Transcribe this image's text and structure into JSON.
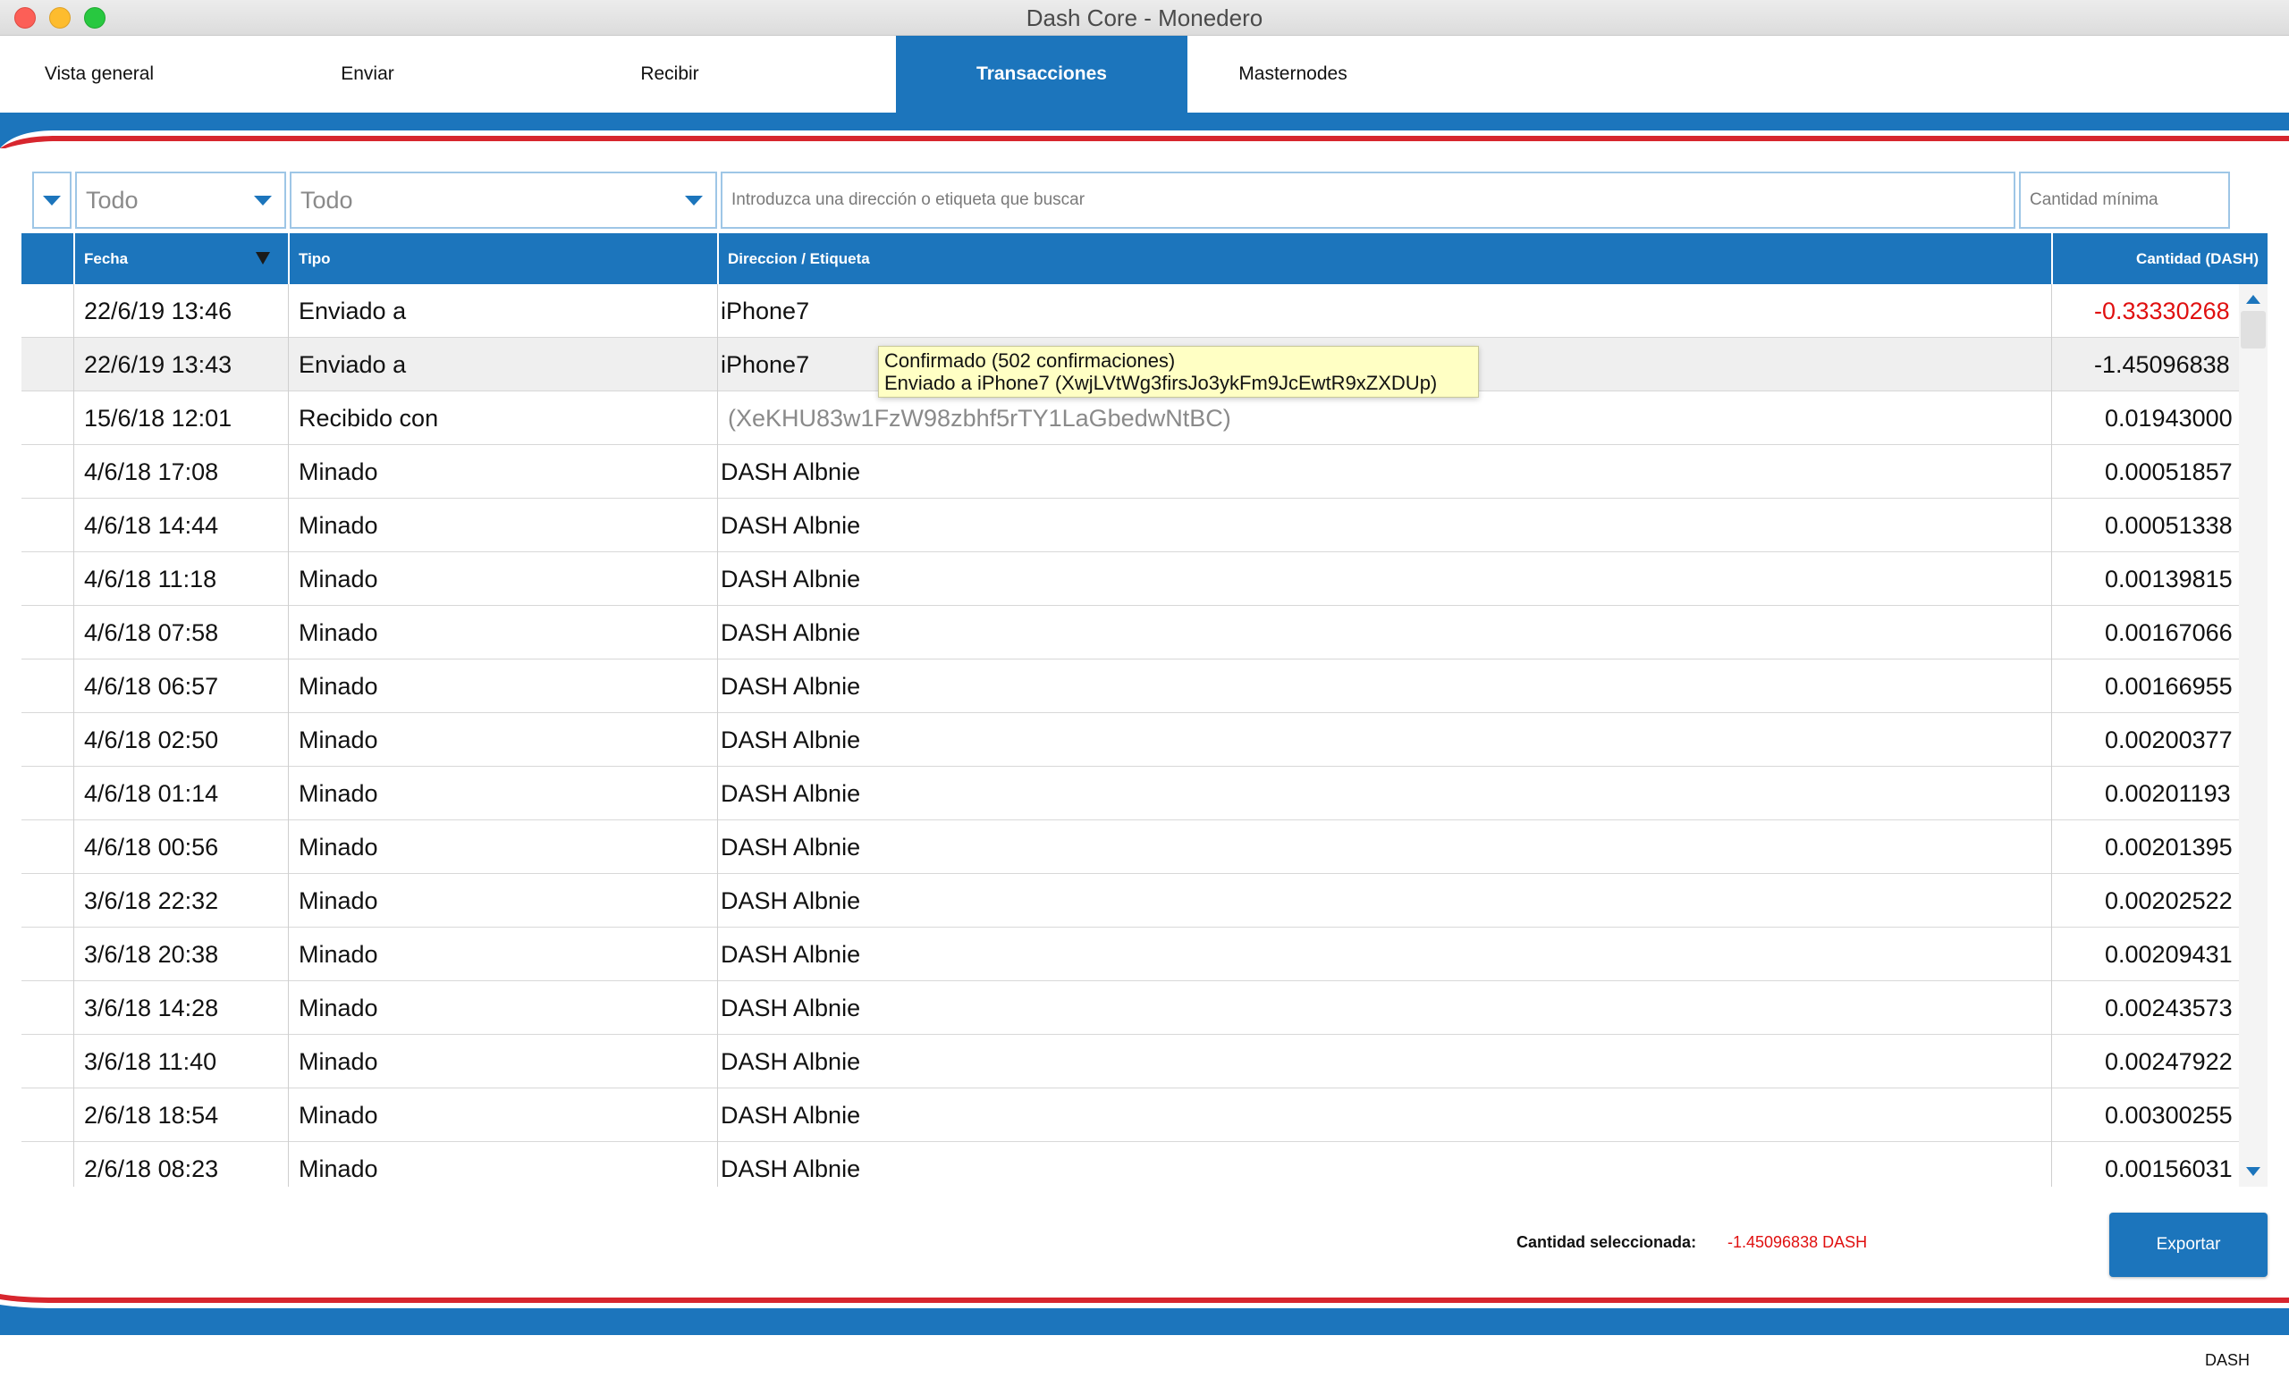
{
  "window": {
    "title": "Dash Core - Monedero"
  },
  "tabs": [
    {
      "label": "Vista general"
    },
    {
      "label": "Enviar"
    },
    {
      "label": "Recibir"
    },
    {
      "label": "Transacciones"
    },
    {
      "label": "Masternodes"
    }
  ],
  "filters": {
    "date_value": "Todo",
    "type_value": "Todo",
    "search_placeholder": "Introduzca una dirección o etiqueta que buscar",
    "min_amount_placeholder": "Cantidad mínima"
  },
  "table": {
    "columns": [
      "Fecha",
      "Tipo",
      "Direccion / Etiqueta",
      "Cantidad (DASH)"
    ],
    "rows": [
      {
        "date": "22/6/19 13:46",
        "type": "Enviado a",
        "label": "iPhone7",
        "amount": "-0.33330268"
      },
      {
        "date": "22/6/19 13:43",
        "type": "Enviado a",
        "label": "iPhone7",
        "amount": "-1.45096838"
      },
      {
        "date": "15/6/18 12:01",
        "type": "Recibido con",
        "label": "(XeKHU83w1FzW98zbhf5rTY1LaGbedwNtBC)",
        "amount": "0.01943000"
      },
      {
        "date": "4/6/18 17:08",
        "type": "Minado",
        "label": "DASH Albnie",
        "amount": "0.00051857"
      },
      {
        "date": "4/6/18 14:44",
        "type": "Minado",
        "label": "DASH Albnie",
        "amount": "0.00051338"
      },
      {
        "date": "4/6/18 11:18",
        "type": "Minado",
        "label": "DASH Albnie",
        "amount": "0.00139815"
      },
      {
        "date": "4/6/18 07:58",
        "type": "Minado",
        "label": "DASH Albnie",
        "amount": "0.00167066"
      },
      {
        "date": "4/6/18 06:57",
        "type": "Minado",
        "label": "DASH Albnie",
        "amount": "0.00166955"
      },
      {
        "date": "4/6/18 02:50",
        "type": "Minado",
        "label": "DASH Albnie",
        "amount": "0.00200377"
      },
      {
        "date": "4/6/18 01:14",
        "type": "Minado",
        "label": "DASH Albnie",
        "amount": "0.00201193"
      },
      {
        "date": "4/6/18 00:56",
        "type": "Minado",
        "label": "DASH Albnie",
        "amount": "0.00201395"
      },
      {
        "date": "3/6/18 22:32",
        "type": "Minado",
        "label": "DASH Albnie",
        "amount": "0.00202522"
      },
      {
        "date": "3/6/18 20:38",
        "type": "Minado",
        "label": "DASH Albnie",
        "amount": "0.00209431"
      },
      {
        "date": "3/6/18 14:28",
        "type": "Minado",
        "label": "DASH Albnie",
        "amount": "0.00243573"
      },
      {
        "date": "3/6/18 11:40",
        "type": "Minado",
        "label": "DASH Albnie",
        "amount": "0.00247922"
      },
      {
        "date": "2/6/18 18:54",
        "type": "Minado",
        "label": "DASH Albnie",
        "amount": "0.00300255"
      },
      {
        "date": "2/6/18 08:23",
        "type": "Minado",
        "label": "DASH Albnie",
        "amount": "0.00156031"
      }
    ]
  },
  "tooltip": {
    "line1": "Confirmado (502 confirmaciones)",
    "line2": "Enviado a iPhone7 (XwjLVtWg3firsJo3ykFm9JcEwtR9xZXDUp)"
  },
  "footer": {
    "selected_label": "Cantidad seleccionada:",
    "selected_value": "-1.45096838 DASH",
    "export_label": "Exportar",
    "unit": "DASH"
  },
  "colors": {
    "accent": "#1c75bc",
    "negative": "#e01010",
    "stripe_red": "#d7262e"
  }
}
